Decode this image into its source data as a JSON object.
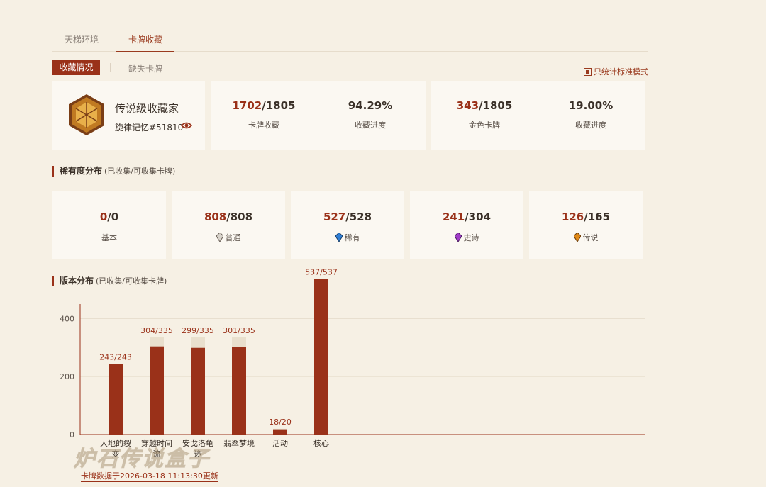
{
  "tabs": [
    {
      "label": "天梯环境",
      "active": false
    },
    {
      "label": "卡牌收藏",
      "active": true
    }
  ],
  "subtabs": {
    "active": "收藏情况",
    "other": "缺失卡牌"
  },
  "standard_mode_label": "只统计标准模式",
  "profile": {
    "title": "传说级收藏家",
    "id": "旋律记忆#51810",
    "icon": "eye-icon"
  },
  "stats": [
    {
      "owned": "1702",
      "total": "/1805",
      "label": "卡牌收藏"
    },
    {
      "value": "94.29%",
      "label": "收藏进度"
    },
    {
      "owned": "343",
      "total": "/1805",
      "label": "金色卡牌"
    },
    {
      "value": "19.00%",
      "label": "收藏进度"
    }
  ],
  "rarity_section": {
    "title": "稀有度分布",
    "sub": "(已收集/可收集卡牌)"
  },
  "rarity": [
    {
      "owned": "0",
      "total": "/0",
      "label": "基本",
      "gem": null
    },
    {
      "owned": "808",
      "total": "/808",
      "label": "普通",
      "gem": "#c9c4bc"
    },
    {
      "owned": "527",
      "total": "/528",
      "label": "稀有",
      "gem": "#2f7fd6"
    },
    {
      "owned": "241",
      "total": "/304",
      "label": "史诗",
      "gem": "#a03cc8"
    },
    {
      "owned": "126",
      "total": "/165",
      "label": "传说",
      "gem": "#e08a18"
    }
  ],
  "version_section": {
    "title": "版本分布",
    "sub": "(已收集/可收集卡牌)"
  },
  "chart_data": {
    "type": "bar",
    "categories": [
      "大地的裂变",
      "穿越时间流",
      "安戈洛龟途",
      "翡翠梦境",
      "活动",
      "核心"
    ],
    "series": [
      {
        "values": [
          243,
          304,
          299,
          301,
          18,
          537
        ]
      },
      {
        "values": [
          243,
          335,
          335,
          335,
          20,
          537
        ]
      }
    ],
    "data_labels": [
      "243/243",
      "304/335",
      "299/335",
      "301/335",
      "18/20",
      "537/537"
    ],
    "yticks": [
      0,
      200,
      400
    ],
    "ylim": [
      0,
      450
    ],
    "grid": true,
    "colors": {
      "owned": "#9a3119",
      "total": "#e9dfcd"
    }
  },
  "footer": "卡牌数据于2026-03-18 11:13:30更新",
  "watermark": "炉石传说盒子"
}
